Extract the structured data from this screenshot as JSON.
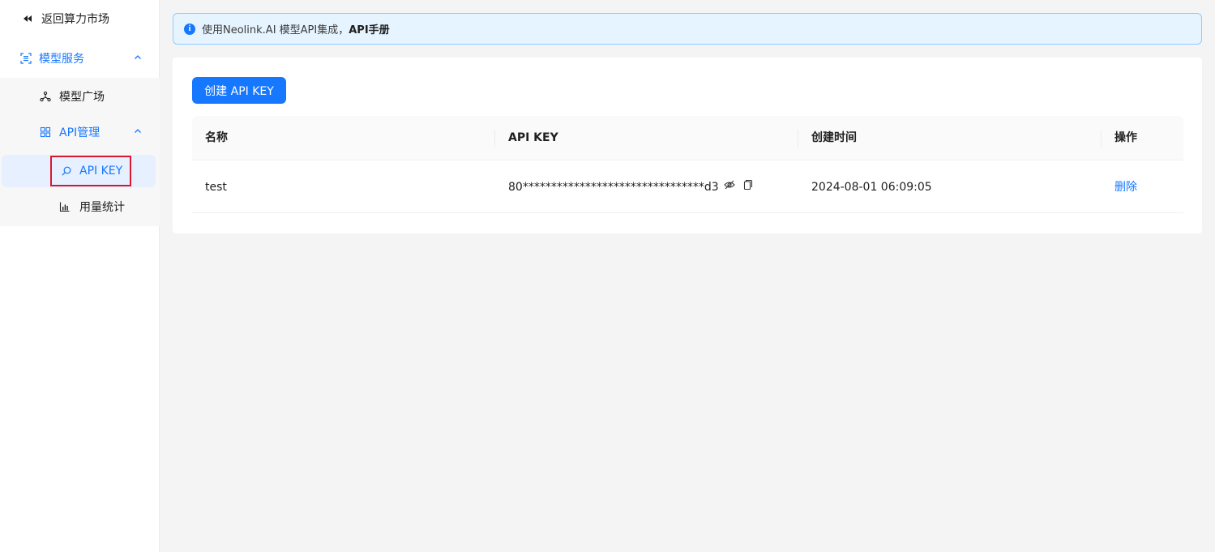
{
  "sidebar": {
    "back_label": "返回算力市场",
    "model_service_label": "模型服务",
    "model_square_label": "模型广场",
    "api_manage_label": "API管理",
    "api_key_label": "API KEY",
    "usage_label": "用量统计"
  },
  "info_bar": {
    "text": "使用Neolink.AI 模型API集成，",
    "link": "API手册"
  },
  "toolbar": {
    "create_label": "创建 API KEY"
  },
  "table": {
    "columns": [
      "名称",
      "API KEY",
      "创建时间",
      "操作"
    ],
    "rows": [
      {
        "name": "test",
        "api_key": "80********************************d3",
        "created": "2024-08-01 06:09:05",
        "action": "删除"
      }
    ]
  },
  "colors": {
    "accent": "#1677ff",
    "highlight_border": "#d9192f"
  }
}
